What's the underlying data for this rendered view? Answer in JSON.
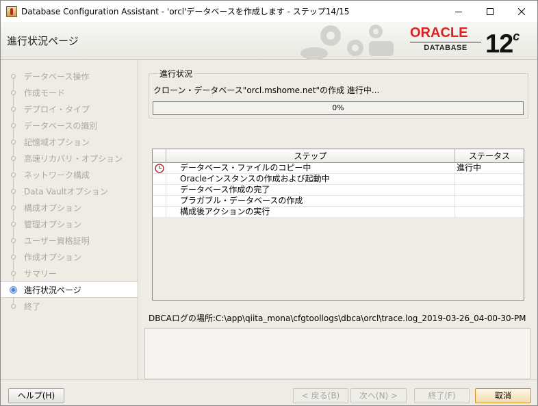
{
  "window": {
    "title": "Database Configuration Assistant - 'orcl'データベースを作成します - ステップ14/15"
  },
  "header": {
    "page_title": "進行状況ページ",
    "logo_oracle": "ORACLE",
    "logo_database": "DATABASE",
    "logo_version": "12",
    "logo_version_suffix": "c"
  },
  "nav": {
    "items": [
      {
        "label": "データベース操作"
      },
      {
        "label": "作成モード"
      },
      {
        "label": "デプロイ・タイプ"
      },
      {
        "label": "データベースの識別"
      },
      {
        "label": "記憶域オプション"
      },
      {
        "label": "高速リカバリ・オプション"
      },
      {
        "label": "ネットワーク構成"
      },
      {
        "label": "Data Vaultオプション"
      },
      {
        "label": "構成オプション"
      },
      {
        "label": "管理オプション"
      },
      {
        "label": "ユーザー資格証明"
      },
      {
        "label": "作成オプション"
      },
      {
        "label": "サマリー"
      },
      {
        "label": "進行状況ページ",
        "active": true
      },
      {
        "label": "終了"
      }
    ]
  },
  "progress": {
    "group_label": "進行状況",
    "status_text": "クローン・データベース\"orcl.mshome.net\"の作成 進行中...",
    "percent_text": "0%",
    "percent_value": 0
  },
  "steps": {
    "headers": {
      "step": "ステップ",
      "status": "ステータス"
    },
    "rows": [
      {
        "step": "データベース・ファイルのコピー中",
        "status": "進行中",
        "icon": "clock-icon"
      },
      {
        "step": "Oracleインスタンスの作成および起動中",
        "status": ""
      },
      {
        "step": "データベース作成の完了",
        "status": ""
      },
      {
        "step": "プラガブル・データベースの作成",
        "status": ""
      },
      {
        "step": "構成後アクションの実行",
        "status": ""
      }
    ]
  },
  "log": {
    "path_text": "DBCAログの場所:C:\\app\\qiita_mona\\cfgtoollogs\\dbca\\orcl\\trace.log_2019-03-26_04-00-30-PM"
  },
  "buttons": {
    "help": "ヘルプ(H)",
    "back": "< 戻る(B)",
    "next": "次へ(N) >",
    "finish": "終了(F)",
    "cancel": "取消"
  },
  "colors": {
    "accent": "#e0201c",
    "progress_fill": "#6d9bd6"
  }
}
